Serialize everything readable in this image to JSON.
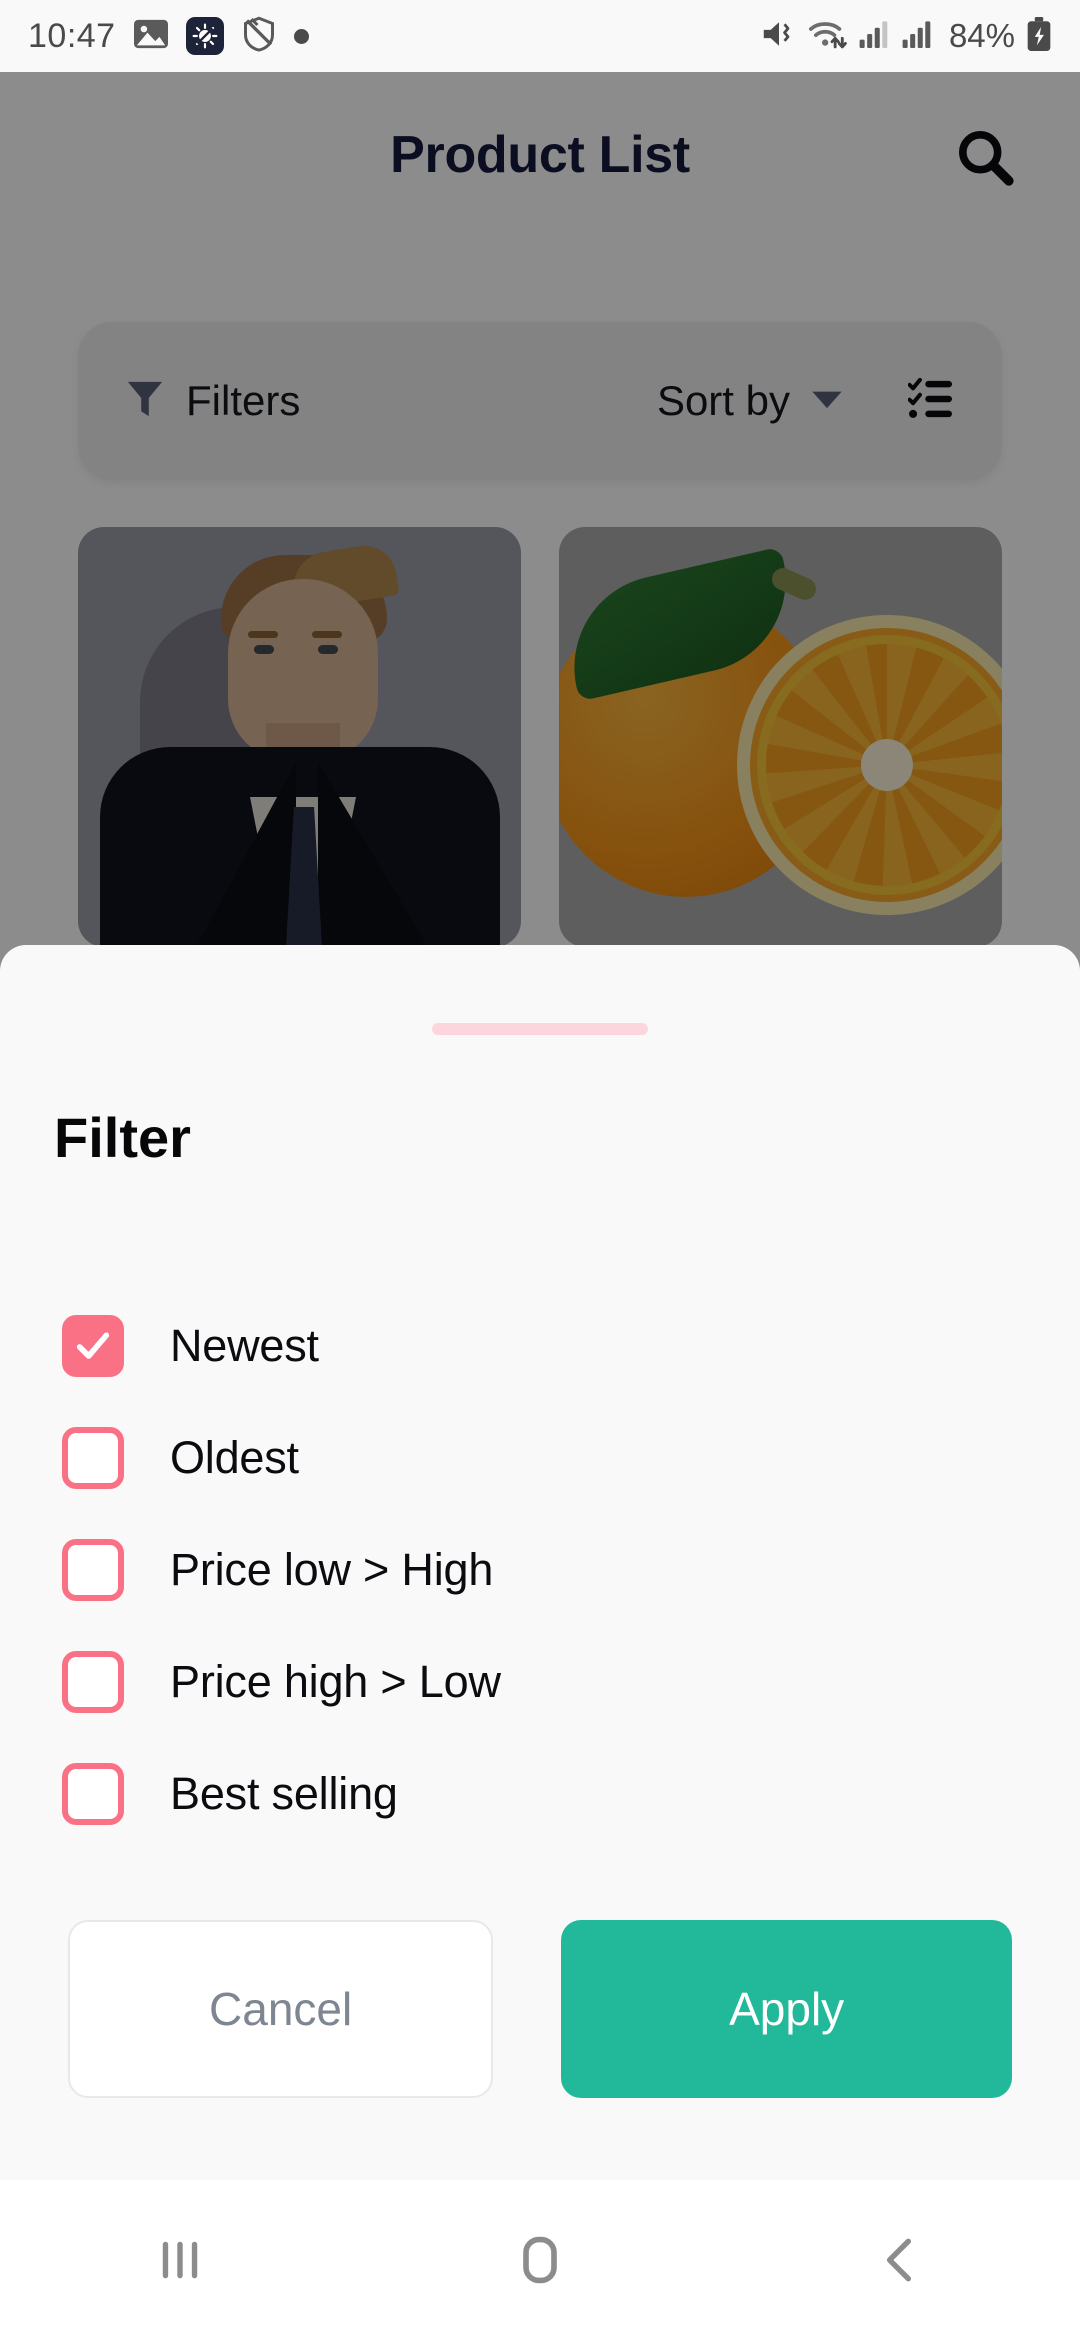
{
  "status_bar": {
    "time": "10:47",
    "battery_percent": "84%",
    "icons": [
      "gallery-icon",
      "app-badge-icon",
      "shield-icon",
      "dot-icon",
      "mute-vibrate-icon",
      "wifi-icon",
      "signal-1-icon",
      "signal-2-icon",
      "battery-charging-icon"
    ]
  },
  "app": {
    "title": "Product List",
    "search_icon": "search-icon",
    "filter_bar": {
      "filter_icon": "funnel-icon",
      "filters_label": "Filters",
      "sort_label": "Sort by",
      "sort_caret_icon": "chevron-down-icon",
      "list_view_icon": "checklist-icon"
    },
    "products": [
      {
        "name": "man-in-suit-product-image"
      },
      {
        "name": "oranges-product-image"
      }
    ]
  },
  "sheet": {
    "handle": "drag-handle",
    "title": "Filter",
    "options": [
      {
        "label": "Newest",
        "checked": true
      },
      {
        "label": "Oldest",
        "checked": false
      },
      {
        "label": "Price low > High",
        "checked": false
      },
      {
        "label": "Price high > Low",
        "checked": false
      },
      {
        "label": "Best selling",
        "checked": false
      }
    ],
    "cancel_label": "Cancel",
    "apply_label": "Apply"
  },
  "nav_bar": {
    "recents_icon": "recents-icon",
    "home_icon": "home-icon",
    "back_icon": "back-icon"
  },
  "colors": {
    "accent_pink": "#FA7186",
    "handle_pink": "#FCD5DD",
    "apply_green": "#22B99A",
    "title_navy": "#151B3B",
    "sheet_bg": "#F9F9FA"
  }
}
